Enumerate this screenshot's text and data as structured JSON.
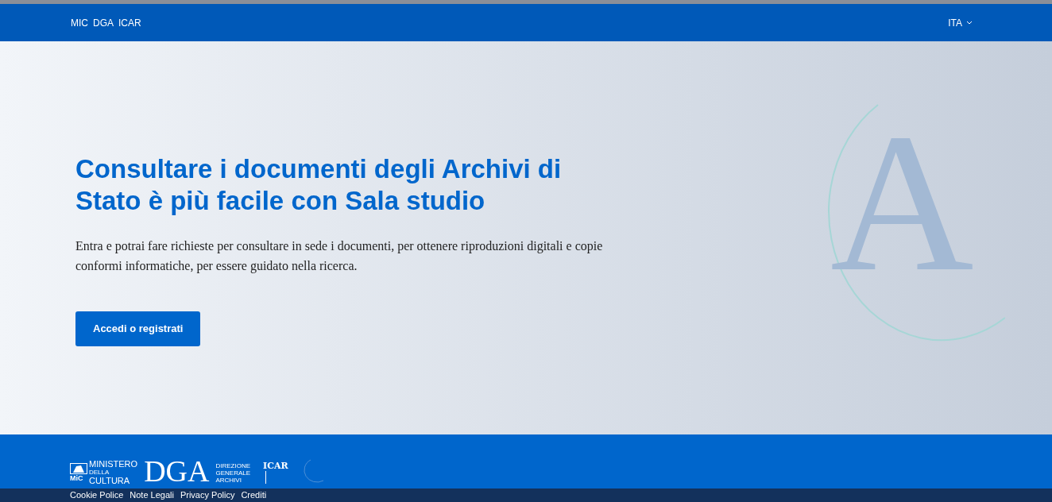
{
  "top_bar": {
    "links": [
      "MIC",
      "DGA",
      "ICAR"
    ],
    "language": "ITA"
  },
  "hero": {
    "title": "Consultare i documenti degli Archivi di Stato è più facile con Sala studio",
    "description": "Entra e potrai fare richieste per consultare in sede i documenti, per ottenere riproduzioni digitali e copie conformi informatiche, per essere guidato nella ricerca.",
    "button": "Accedi o registrati",
    "logo_letter": "A"
  },
  "footer": {
    "mic_logo": {
      "lines": [
        "MINISTERO",
        "DELLA",
        "CULTURA"
      ],
      "abbr": "MiC"
    },
    "dga_logo": {
      "mark": "DGA",
      "lines": [
        "DIREZIONE",
        "GENERALE",
        "ARCHIVI"
      ]
    },
    "icar_logo": "ICAR",
    "links": [
      "Cookie Police",
      "Note Legali",
      "Privacy Policy",
      "Crediti"
    ]
  }
}
